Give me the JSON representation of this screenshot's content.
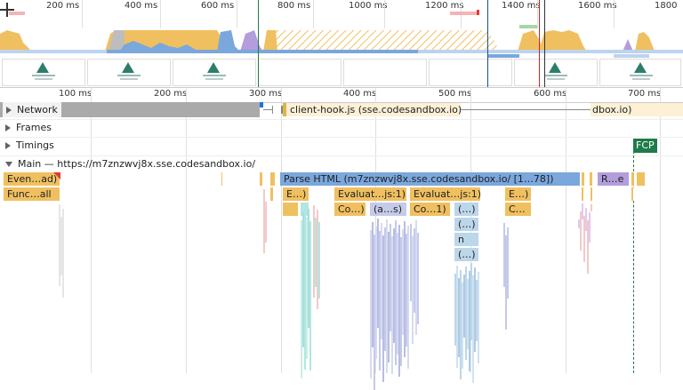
{
  "overview": {
    "ticks": [
      "200 ms",
      "400 ms",
      "600 ms",
      "800 ms",
      "1000 ms",
      "1200 ms",
      "1400 ms",
      "1600 ms",
      "1800"
    ]
  },
  "ruler": {
    "ticks": [
      "100 ms",
      "200 ms",
      "300 ms",
      "400 ms",
      "500 ms",
      "600 ms",
      "700 ms"
    ]
  },
  "tracks": {
    "network": {
      "label": "Network",
      "request1": "client-hook.js (sse.codesandbox.io)",
      "request2": "dbox.io)"
    },
    "frames": {
      "label": "Frames"
    },
    "timings": {
      "label": "Timings",
      "fcp": "FCP"
    },
    "main": {
      "label": "Main — https://m7znzwvj8x.sse.codesandbox.io/"
    }
  },
  "flame": {
    "row1": {
      "event": "Even…ad)",
      "parse": "Parse HTML (m7znzwvj8x.sse.codesandbox.io/ [1…78])",
      "re": "R…e"
    },
    "row2": {
      "func": "Func…all",
      "e1": "E…)",
      "eval1": "Evaluat…js:1)",
      "eval2": "Evaluat…js:1)",
      "e2": "E…)"
    },
    "row3": {
      "co1": "Co…)",
      "as": "(a…s)",
      "co2": "Co…1)",
      "anon1": "(…)",
      "c": "C…"
    },
    "row4": {
      "anon": "(…)"
    },
    "row5": {
      "n": "n"
    },
    "row6": {
      "anon": "(…)"
    }
  },
  "colors": {
    "scripting": "#f0c060",
    "parse": "#7aa7dc",
    "rendering": "#b39ddb",
    "fcp": "#1e7b4a",
    "cpu_blue": "#7aa7dc",
    "idle_gray": "#bdbdbd"
  }
}
